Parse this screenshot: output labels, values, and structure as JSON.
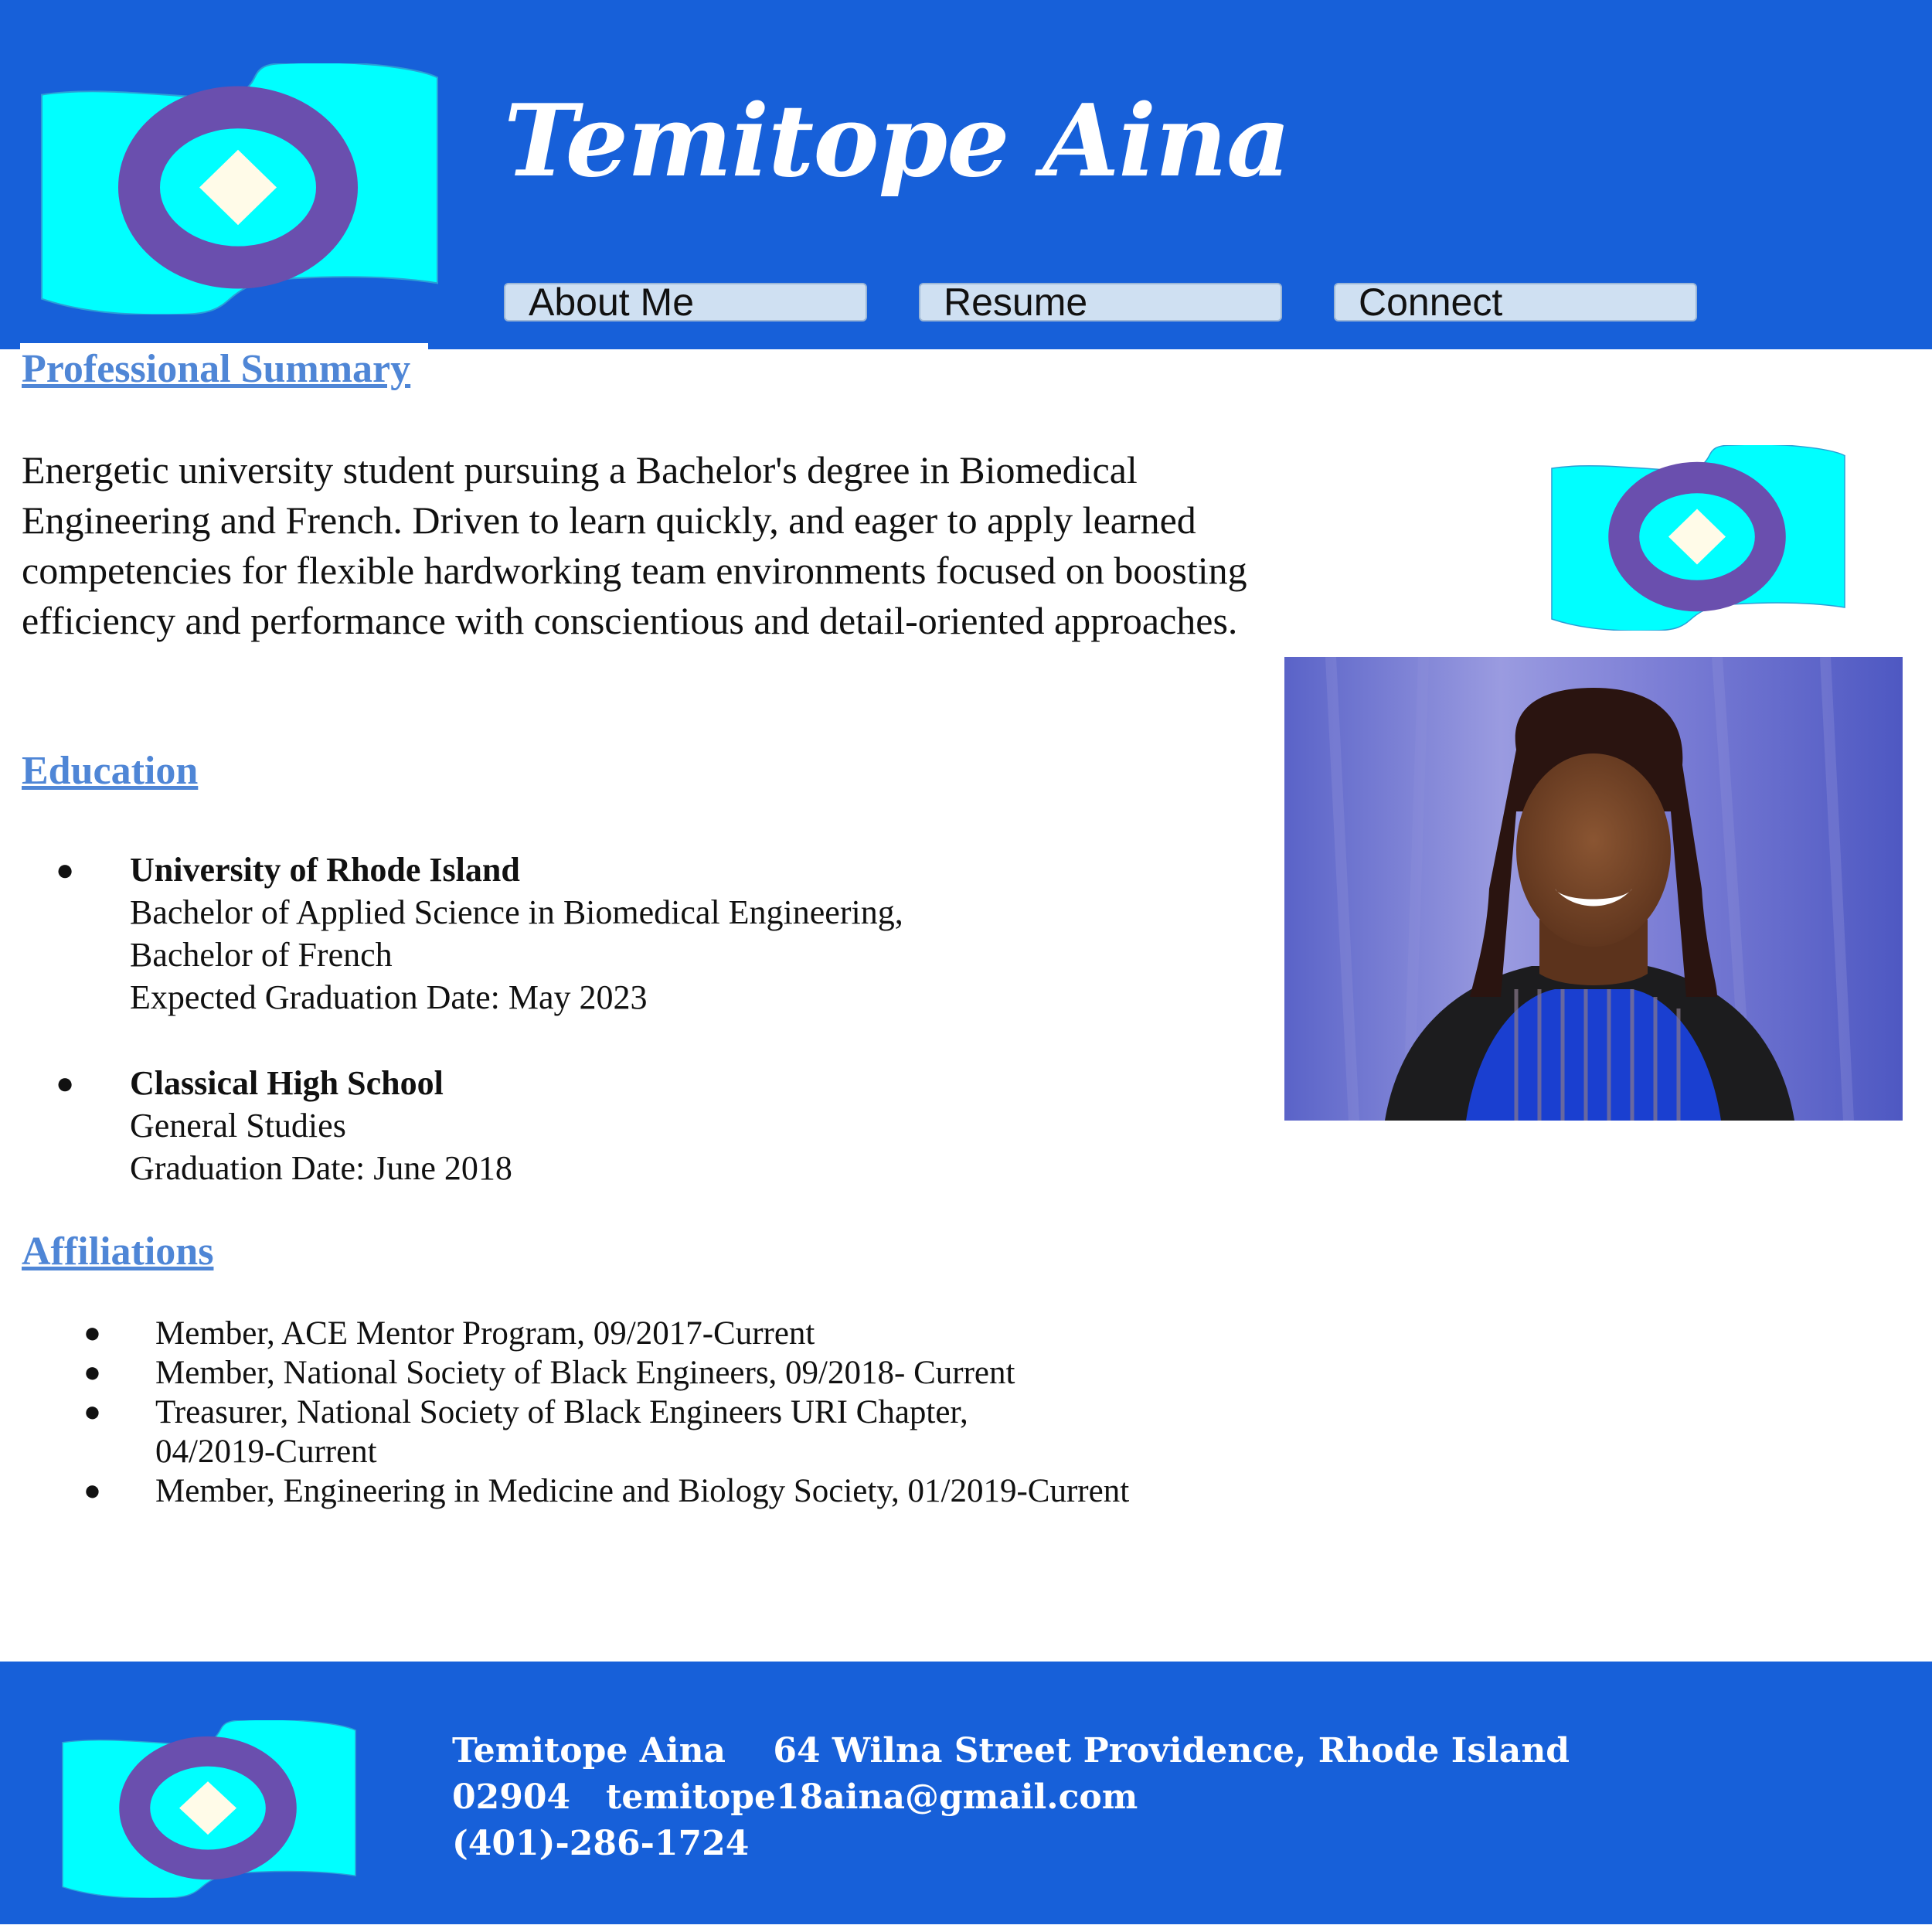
{
  "header": {
    "name": "Temitope Aina",
    "nav": [
      {
        "label": "About Me"
      },
      {
        "label": "Resume"
      },
      {
        "label": "Connect"
      }
    ]
  },
  "summary": {
    "heading": "Professional Summary",
    "text": "Energetic university student pursuing a Bachelor's degree in Biomedical Engineering and French. Driven to learn quickly, and eager to apply learned competencies for flexible hardworking team environments focused on boosting efficiency and performance with conscientious and detail-oriented approaches."
  },
  "education": {
    "heading": "Education",
    "items": [
      {
        "name": "University of Rhode Island",
        "lines": [
          "Bachelor of Applied Science in Biomedical Engineering,",
          "Bachelor of French",
          "Expected Graduation Date: May 2023"
        ]
      },
      {
        "name": "Classical High School",
        "lines": [
          "General Studies",
          "Graduation Date: June 2018"
        ]
      }
    ]
  },
  "affiliations": {
    "heading": "Affiliations",
    "items": [
      "Member, ACE Mentor Program, 09/2017-Current",
      "Member, National Society of Black Engineers, 09/2018- Current",
      "Treasurer, National Society of Black Engineers URI Chapter, 04/2019-Current",
      "Member, Engineering in Medicine and Biology Society, 01/2019-Current"
    ]
  },
  "footer": {
    "line1": "Temitope Aina    64 Wilna Street Providence, Rhode Island",
    "line2": "02904   temitope18aina@gmail.com",
    "line3": "(401)-286-1724"
  },
  "colors": {
    "header_bg": "#1760d9",
    "flag_cyan": "#00ffff",
    "ring_purple": "#6a4fae",
    "diamond": "#fffbe8",
    "heading_link": "#4f86d6",
    "nav_button": "#cfe0f2"
  },
  "icons": {
    "logo": "flag-logo-icon",
    "bullet": "bullet-icon"
  }
}
